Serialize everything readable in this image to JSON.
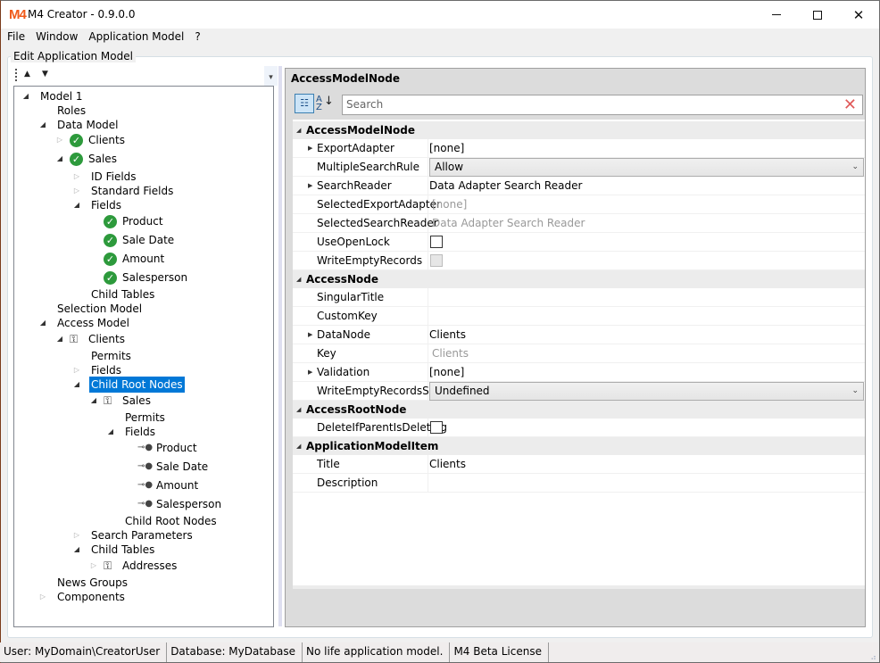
{
  "window": {
    "logo": "M4",
    "title": "M4 Creator - 0.9.0.0",
    "controls": {
      "minimize": "minimize",
      "maximize": "maximize",
      "close": "✕"
    }
  },
  "menu": [
    "File",
    "Window",
    "Application Model",
    "?"
  ],
  "group": {
    "title": "Edit Application Model"
  },
  "tree_toolbar": {
    "move_up": "▲",
    "move_down": "▼",
    "overflow": "⩡"
  },
  "tree": [
    {
      "label": "Model 1",
      "level": 0,
      "toggle": "open",
      "icon": null
    },
    {
      "label": "Roles",
      "level": 1,
      "toggle": null,
      "icon": null
    },
    {
      "label": "Data Model",
      "level": 1,
      "toggle": "open",
      "icon": null
    },
    {
      "label": "Clients",
      "level": 2,
      "toggle": "closed",
      "icon": "check"
    },
    {
      "label": "Sales",
      "level": 2,
      "toggle": "open",
      "icon": "check"
    },
    {
      "label": "ID Fields",
      "level": 3,
      "toggle": "closed",
      "icon": null
    },
    {
      "label": "Standard Fields",
      "level": 3,
      "toggle": "closed",
      "icon": null
    },
    {
      "label": "Fields",
      "level": 3,
      "toggle": "open",
      "icon": null
    },
    {
      "label": "Product",
      "level": 4,
      "toggle": null,
      "icon": "check"
    },
    {
      "label": "Sale Date",
      "level": 4,
      "toggle": null,
      "icon": "check"
    },
    {
      "label": "Amount",
      "level": 4,
      "toggle": null,
      "icon": "check"
    },
    {
      "label": "Salesperson",
      "level": 4,
      "toggle": null,
      "icon": "check"
    },
    {
      "label": "Child Tables",
      "level": 3,
      "toggle": null,
      "icon": null
    },
    {
      "label": "Selection Model",
      "level": 1,
      "toggle": null,
      "icon": null
    },
    {
      "label": "Access Model",
      "level": 1,
      "toggle": "open",
      "icon": null
    },
    {
      "label": "Clients",
      "level": 2,
      "toggle": "open",
      "icon": "access"
    },
    {
      "label": "Permits",
      "level": 3,
      "toggle": null,
      "icon": null
    },
    {
      "label": "Fields",
      "level": 3,
      "toggle": "closed",
      "icon": null
    },
    {
      "label": "Child Root Nodes",
      "level": 3,
      "toggle": "open",
      "icon": null,
      "selected": true
    },
    {
      "label": "Sales",
      "level": 4,
      "toggle": "open",
      "icon": "access"
    },
    {
      "label": "Permits",
      "level": 5,
      "toggle": null,
      "icon": null
    },
    {
      "label": "Fields",
      "level": 5,
      "toggle": "open",
      "icon": null
    },
    {
      "label": "Product",
      "level": 6,
      "toggle": null,
      "icon": "key"
    },
    {
      "label": "Sale Date",
      "level": 6,
      "toggle": null,
      "icon": "key"
    },
    {
      "label": "Amount",
      "level": 6,
      "toggle": null,
      "icon": "key"
    },
    {
      "label": "Salesperson",
      "level": 6,
      "toggle": null,
      "icon": "key"
    },
    {
      "label": "Child Root Nodes",
      "level": 5,
      "toggle": null,
      "icon": null
    },
    {
      "label": "Search Parameters",
      "level": 3,
      "toggle": "closed",
      "icon": null
    },
    {
      "label": "Child Tables",
      "level": 3,
      "toggle": "open",
      "icon": null
    },
    {
      "label": "Addresses",
      "level": 4,
      "toggle": "closed",
      "icon": "access"
    },
    {
      "label": "News Groups",
      "level": 1,
      "toggle": null,
      "icon": null
    },
    {
      "label": "Components",
      "level": 1,
      "toggle": "closed",
      "icon": null
    }
  ],
  "property_grid": {
    "title": "AccessModelNode",
    "search_placeholder": "Search",
    "categorized_icon": "categorized-view",
    "alphabetical_icon": "A-Z sort",
    "categories": [
      {
        "name": "AccessModelNode",
        "properties": [
          {
            "name": "ExportAdapter",
            "value": "[none]",
            "expandable": true,
            "type": "text"
          },
          {
            "name": "MultipleSearchRule",
            "value": "Allow",
            "type": "combo"
          },
          {
            "name": "SearchReader",
            "value": "Data Adapter Search Reader",
            "expandable": true,
            "type": "text"
          },
          {
            "name": "SelectedExportAdapter",
            "value": "[none]",
            "type": "readonly"
          },
          {
            "name": "SelectedSearchReader",
            "value": "Data Adapter Search Reader",
            "type": "readonly"
          },
          {
            "name": "UseOpenLock",
            "value": false,
            "type": "checkbox"
          },
          {
            "name": "WriteEmptyRecords",
            "value": false,
            "type": "checkbox-disabled"
          }
        ]
      },
      {
        "name": "AccessNode",
        "properties": [
          {
            "name": "SingularTitle",
            "value": "",
            "type": "text"
          },
          {
            "name": "CustomKey",
            "value": "",
            "type": "text"
          },
          {
            "name": "DataNode",
            "value": "Clients",
            "expandable": true,
            "type": "text"
          },
          {
            "name": "Key",
            "value": "Clients",
            "type": "readonly"
          },
          {
            "name": "Validation",
            "value": "[none]",
            "expandable": true,
            "type": "text"
          },
          {
            "name": "WriteEmptyRecordsSet...",
            "value": "Undefined",
            "type": "combo"
          }
        ]
      },
      {
        "name": "AccessRootNode",
        "properties": [
          {
            "name": "DeleteIfParentIsDeleting",
            "value": false,
            "type": "checkbox"
          }
        ]
      },
      {
        "name": "ApplicationModelItem",
        "properties": [
          {
            "name": "Title",
            "value": "Clients",
            "type": "text"
          },
          {
            "name": "Description",
            "value": "",
            "type": "text"
          }
        ]
      }
    ]
  },
  "statusbar": [
    "User: MyDomain\\CreatorUser",
    "Database: MyDatabase",
    "No life application model.",
    "M4 Beta License"
  ]
}
